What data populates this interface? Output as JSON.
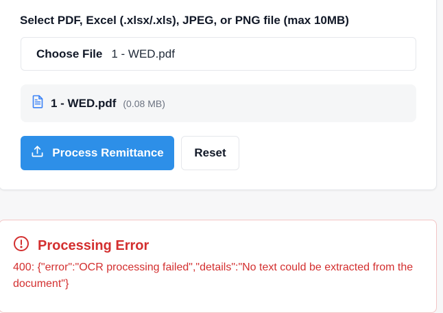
{
  "upload": {
    "label": "Select PDF, Excel (.xlsx/.xls), JPEG, or PNG file (max 10MB)",
    "choose_button": "Choose File",
    "chosen_file": "1 - WED.pdf"
  },
  "preview": {
    "icon": "document-icon",
    "file_name": "1 - WED.pdf",
    "file_size": "(0.08 MB)"
  },
  "actions": {
    "process_label": "Process Remittance",
    "process_icon": "upload-icon",
    "reset_label": "Reset"
  },
  "error": {
    "icon": "alert-circle-icon",
    "title": "Processing Error",
    "message": "400: {\"error\":\"OCR processing failed\",\"details\":\"No text could be extracted from the document\"}"
  },
  "colors": {
    "primary": "#2d8fe8",
    "error": "#d32f2f",
    "error_border": "#f3c4c4",
    "icon_blue": "#3b82f6"
  }
}
